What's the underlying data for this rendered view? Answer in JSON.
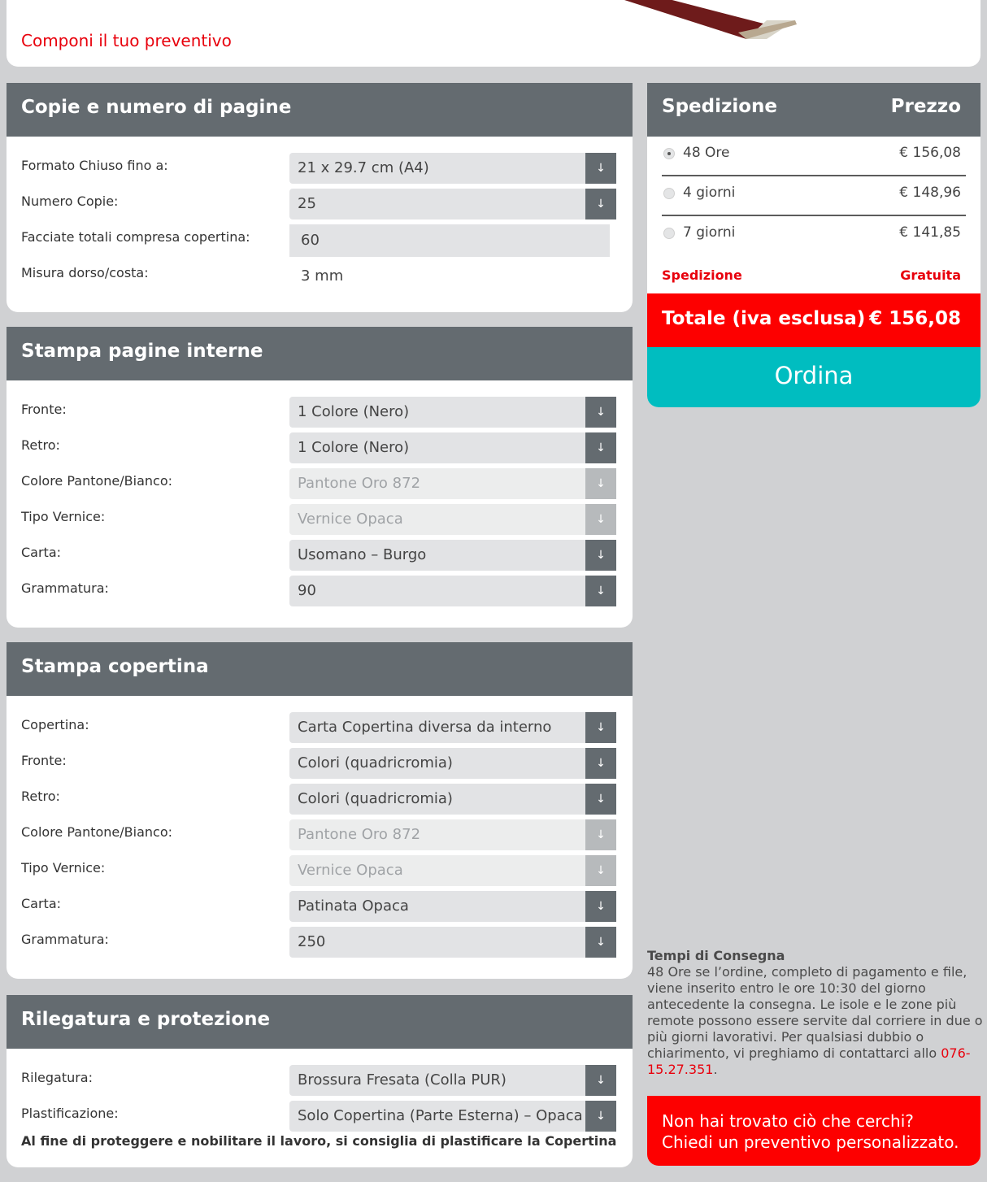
{
  "header": {
    "title": "Componi il tuo preventivo"
  },
  "section_copie": {
    "title": "Copie e numero di pagine",
    "rows": [
      {
        "label": "Formato Chiuso fino a:",
        "value": "21 x 29.7 cm (A4)"
      },
      {
        "label": "Numero Copie:",
        "value": "25"
      },
      {
        "label": "Facciate totali compresa copertina:",
        "value": "60"
      },
      {
        "label": "Misura dorso/costa:",
        "value": "3 mm"
      }
    ]
  },
  "section_interne": {
    "title": "Stampa pagine interne",
    "rows": [
      {
        "label": "Fronte:",
        "value": "1 Colore (Nero)"
      },
      {
        "label": "Retro:",
        "value": "1 Colore (Nero)"
      },
      {
        "label": "Colore Pantone/Bianco:",
        "value": "Pantone Oro 872"
      },
      {
        "label": "Tipo Vernice:",
        "value": "Vernice Opaca"
      },
      {
        "label": "Carta:",
        "value": "Usomano – Burgo"
      },
      {
        "label": "Grammatura:",
        "value": "90"
      }
    ]
  },
  "section_copertina": {
    "title": "Stampa copertina",
    "rows": [
      {
        "label": "Copertina:",
        "value": "Carta Copertina diversa da interno"
      },
      {
        "label": "Fronte:",
        "value": "Colori (quadricromia)"
      },
      {
        "label": "Retro:",
        "value": "Colori (quadricromia)"
      },
      {
        "label": "Colore Pantone/Bianco:",
        "value": "Pantone Oro 872"
      },
      {
        "label": "Tipo Vernice:",
        "value": "Vernice Opaca"
      },
      {
        "label": "Carta:",
        "value": "Patinata Opaca"
      },
      {
        "label": "Grammatura:",
        "value": "250"
      }
    ]
  },
  "section_rilegatura": {
    "title": "Rilegatura e protezione",
    "rows": [
      {
        "label": "Rilegatura:",
        "value": "Brossura Fresata (Colla PUR)"
      },
      {
        "label": "Plastificazione:",
        "value": "Solo Copertina (Parte Esterna) – Opaca"
      }
    ],
    "note": "Al fine di proteggere e nobilitare il lavoro, si consiglia di plastificare la Copertina"
  },
  "shipping": {
    "col_left": "Spedizione",
    "col_right": "Prezzo",
    "options": [
      {
        "name": "48 Ore",
        "price": "€ 156,08",
        "selected": true
      },
      {
        "name": "4 giorni",
        "price": "€ 148,96",
        "selected": false
      },
      {
        "name": "7 giorni",
        "price": "€ 141,85",
        "selected": false
      }
    ],
    "free_label": "Spedizione",
    "free_value": "Gratuita",
    "total_label": "Totale (iva esclusa)",
    "total_value": "€ 156,08",
    "order_label": "Ordina"
  },
  "delivery": {
    "heading": "Tempi di Consegna",
    "text": "48 Ore se l’ordine, completo di pagamento e file, viene inserito entro le ore 10:30 del giorno antecedente la consegna. Le isole e le zone più remote possono essere servite dal corriere in due o più giorni lavorativi. Per qualsiasi dubbio o chiarimento, vi preghiamo di contattarci allo ",
    "phone": "076-15.27.351",
    "tail": "."
  },
  "custom_quote": {
    "line1": "Non hai trovato ciò che cerchi?",
    "line2": "Chiedi un preventivo personalizzato."
  },
  "colors": {
    "header_gray": "#646b70",
    "accent_red": "#fd0000",
    "accent_teal": "#00bdc0"
  }
}
